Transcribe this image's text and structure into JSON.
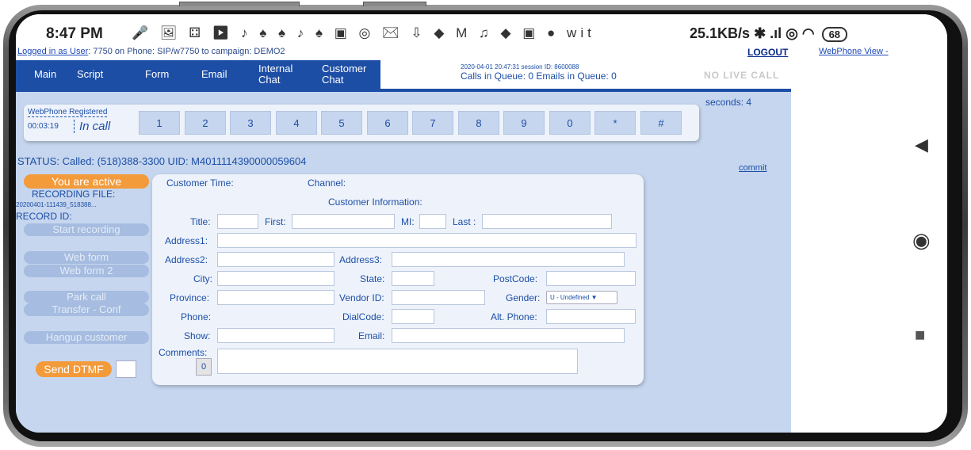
{
  "status_bar": {
    "time": "8:47 PM",
    "notification_icons": "🎤 🖼 ⚃ ▶ ♪ ♠ ♠ ♪ ♠ ▣ ◎ ✉ ⇩ ◆ M ♫ ◆ ▣ ● wit",
    "net_speed": "25.1KB/s",
    "signal": "✱ .ıl ◎ ◠",
    "battery": "68"
  },
  "header": {
    "logged_in_prefix": "Logged in as User",
    "logged_in_rest": ": 7750 on Phone: SIP/w7750  to campaign: DEMO2",
    "logout": "LOGOUT",
    "webphone_view": "WebPhone View -"
  },
  "nav": {
    "tabs": [
      {
        "label": "Main"
      },
      {
        "label": "Script"
      },
      {
        "label": "Form"
      },
      {
        "label": "Email"
      },
      {
        "label": "Internal Chat"
      },
      {
        "label": "Customer Chat"
      }
    ],
    "session_line": "2020-04-01 20:47:31   session ID: 8600088",
    "queue_line": "Calls in Queue: 0   Emails in Queue: 0",
    "no_live_call": "NO LIVE CALL"
  },
  "webphone": {
    "registered": "WebPhone Registered",
    "timer": "00:03:19",
    "state": "In call",
    "keys": [
      "1",
      "2",
      "3",
      "4",
      "5",
      "6",
      "7",
      "8",
      "9",
      "0",
      "*",
      "#"
    ]
  },
  "seconds": "seconds: 4",
  "status_line": "STATUS: Called: (518)388-3300 UID: M4011114390000059604",
  "commit": "commit",
  "left_panel": {
    "active": "You are active",
    "recording_file_label": "RECORDING FILE:",
    "recording_file": "20200401-111439_518388...",
    "record_id_label": "RECORD ID:",
    "start_recording": "Start recording",
    "web_form": "Web form",
    "web_form_2": "Web form 2",
    "park_call": "Park call",
    "transfer_conf": "Transfer - Conf",
    "hangup": "Hangup customer",
    "send_dtmf": "Send DTMF"
  },
  "form": {
    "customer_time": "Customer Time:",
    "channel": "Channel:",
    "customer_information": "Customer Information:",
    "title": "Title:",
    "first": "First:",
    "mi": "MI:",
    "last": "Last :",
    "address1": "Address1:",
    "address2": "Address2:",
    "address3": "Address3:",
    "city": "City:",
    "state": "State:",
    "postcode": "PostCode:",
    "province": "Province:",
    "vendor_id": "Vendor ID:",
    "gender": "Gender:",
    "gender_value": "U - Undefined ▼",
    "phone": "Phone:",
    "dialcode": "DialCode:",
    "alt_phone": "Alt. Phone:",
    "show": "Show:",
    "email": "Email:",
    "comments": "Comments:",
    "comments_count": "0"
  },
  "android_nav": {
    "back": "◀",
    "home": "◉",
    "recents": "■"
  }
}
